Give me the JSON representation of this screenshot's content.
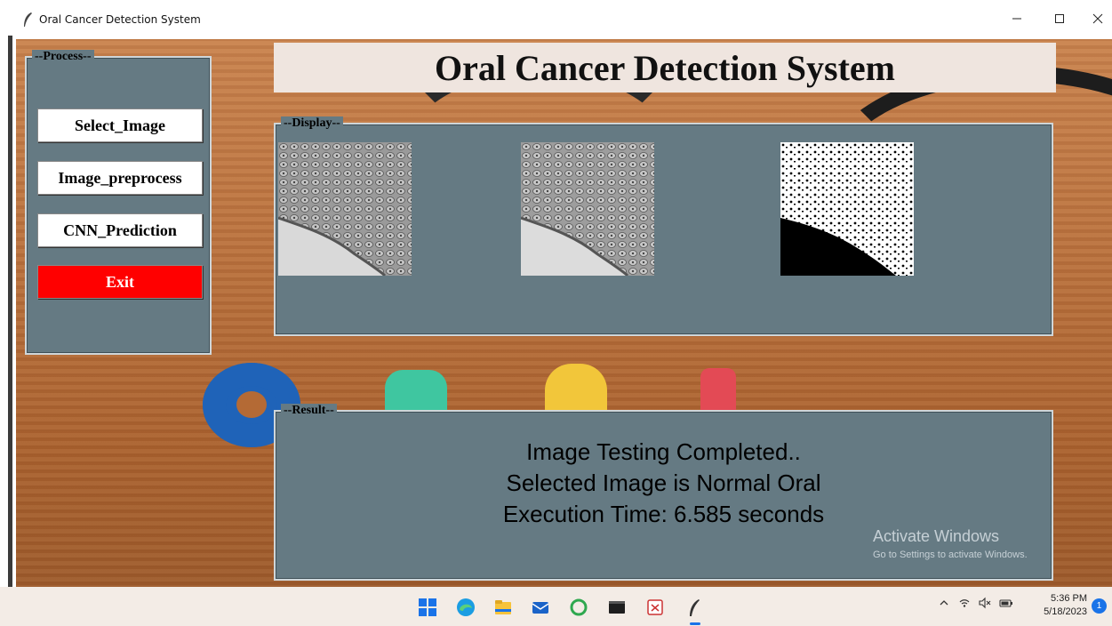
{
  "window": {
    "title": "Oral Cancer Detection System",
    "minimize_icon": "minimize-icon",
    "maximize_icon": "maximize-icon",
    "close_icon": "close-icon"
  },
  "header": {
    "banner_title": "Oral Cancer Detection System"
  },
  "process": {
    "label": "--Process--",
    "buttons": {
      "select_image": "Select_Image",
      "image_preprocess": "Image_preprocess",
      "cnn_prediction": "CNN_Prediction",
      "exit": "Exit"
    }
  },
  "display": {
    "label": "--Display--",
    "images": [
      {
        "name": "original-image"
      },
      {
        "name": "preprocessed-image"
      },
      {
        "name": "binary-image"
      }
    ]
  },
  "result": {
    "label": "--Result--",
    "lines": [
      "Image Testing Completed..",
      "Selected Image is Normal Oral",
      "Execution Time: 6.585 seconds"
    ]
  },
  "watermark": {
    "title": "Activate Windows",
    "subtitle": "Go to Settings to activate Windows."
  },
  "taskbar": {
    "icons": [
      "windows-start-icon",
      "edge-browser-icon",
      "file-explorer-icon",
      "mail-icon",
      "circle-app-icon",
      "terminal-icon",
      "snipping-tool-icon",
      "python-feather-icon"
    ],
    "tray_icons": [
      "chevron-up-icon",
      "wifi-icon",
      "speaker-muted-icon",
      "battery-icon"
    ],
    "clock_time": "5:36 PM",
    "clock_date": "5/18/2023",
    "notification_count": "1"
  },
  "colors": {
    "panel": "#657a83",
    "exit_button": "#ff0000",
    "banner": "#efe5df"
  }
}
